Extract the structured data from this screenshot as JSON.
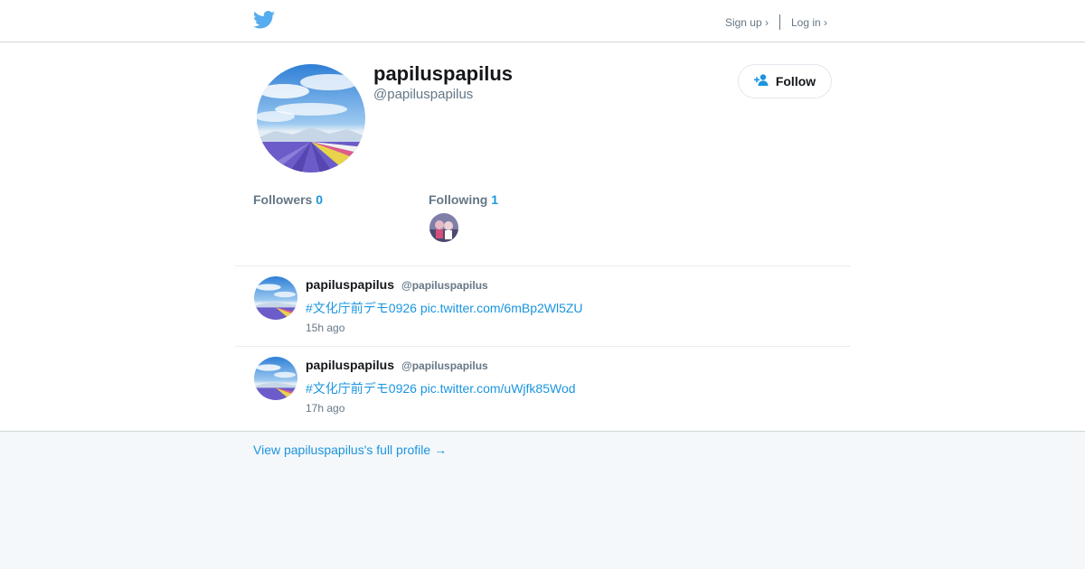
{
  "header": {
    "logo_icon": "twitter-bird-icon",
    "signup_label": "Sign up ›",
    "login_label": "Log in ›"
  },
  "profile": {
    "display_name": "papiluspapilus",
    "screen_name": "@papiluspapilus",
    "follow_label": "Follow",
    "follow_icon": "add-user-icon",
    "followers_label": "Followers",
    "followers_count": "0",
    "following_label": "Following",
    "following_count": "1"
  },
  "tweets": [
    {
      "name": "papiluspapilus",
      "handle": "@papiluspapilus",
      "hashtag": "#文化庁前デモ0926",
      "link": "pic.twitter.com/6mBp2Wl5ZU",
      "time": "15h ago"
    },
    {
      "name": "papiluspapilus",
      "handle": "@papiluspapilus",
      "hashtag": "#文化庁前デモ0926",
      "link": "pic.twitter.com/uWjfk85Wod",
      "time": "17h ago"
    }
  ],
  "footer": {
    "full_profile_link": "View papiluspapilus's full profile →"
  },
  "colors": {
    "accent": "#1b95e0",
    "twitter_blue": "#55acee",
    "muted_text": "#657786",
    "page_bg": "#f5f8fa"
  }
}
